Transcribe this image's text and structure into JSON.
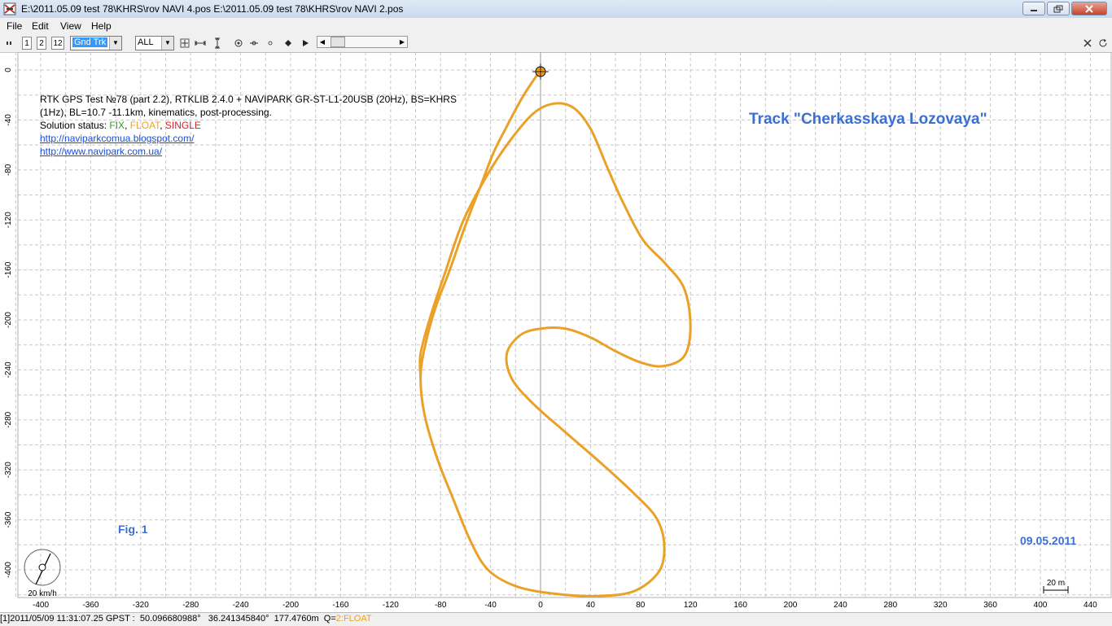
{
  "window": {
    "title": "E:\\2011.05.09 test 78\\KHRS\\rov NAVI 4.pos E:\\2011.05.09 test 78\\KHRS\\rov NAVI 2.pos",
    "min_icon": "minimize-icon",
    "max_icon": "maximize-icon",
    "close_icon": "close-icon"
  },
  "menu": {
    "file": "File",
    "edit": "Edit",
    "view": "View",
    "help": "Help"
  },
  "toolbar": {
    "btn1": "1",
    "btn2": "2",
    "btn12": "12",
    "plot_type": "Gnd Trk",
    "quality": "ALL"
  },
  "annotation": {
    "line1": "RTK GPS Test №78 (part 2.2), RTKLIB 2.4.0 + NAVIPARK GR-ST-L1-20USB (20Hz), BS=KHRS",
    "line2": "(1Hz), BL=10.7 -11.1km, kinematics, post-processing.",
    "status_label": "Solution status: ",
    "fix": "FIX",
    "float": "FLOAT",
    "single": "SINGLE",
    "sep": ", ",
    "link1": "http://naviparkcomua.blogspot.com/",
    "link2": "http://www.navipark.com.ua/"
  },
  "track_title": "Track \"Cherkasskaya Lozovaya\"",
  "fig_label": "Fig. 1",
  "date_label": "09.05.2011",
  "scale_label": "20 m",
  "velocity_label": "20 km/h",
  "status_bar": {
    "left": "[1]2011/05/09 11:31:07.25 GPST :  50.096680988°   36.241345840°  177.4760m  Q=",
    "quality": "2:FLOAT"
  },
  "colors": {
    "fix": "#2e9e2e",
    "float": "#f0a020",
    "single": "#e02020",
    "track": "#eaa128",
    "accent": "#3c6fd0"
  },
  "chart_data": {
    "type": "line",
    "xlim": [
      -400,
      440
    ],
    "ylim": [
      -400,
      0
    ],
    "xticks": [
      -400,
      -360,
      -320,
      -280,
      -240,
      -200,
      -160,
      -120,
      -80,
      -40,
      0,
      40,
      80,
      120,
      160,
      200,
      240,
      280,
      320,
      360,
      400,
      440
    ],
    "yticks": [
      0,
      -40,
      -80,
      -120,
      -160,
      -200,
      -240,
      -280,
      -320,
      -360,
      -400
    ],
    "grid": true,
    "series": [
      {
        "points": [
          [
            0,
            0
          ],
          [
            -14,
            -21
          ],
          [
            -28,
            -47
          ],
          [
            -38,
            -67
          ],
          [
            -48,
            -93
          ],
          [
            -60,
            -124
          ],
          [
            -73,
            -161
          ],
          [
            -84,
            -190
          ],
          [
            -92,
            -219
          ],
          [
            -96,
            -245
          ],
          [
            -93,
            -275
          ],
          [
            -83,
            -310
          ],
          [
            -70,
            -343
          ],
          [
            -56,
            -377
          ],
          [
            -42,
            -400
          ],
          [
            -20,
            -413
          ],
          [
            10,
            -419
          ],
          [
            45,
            -421
          ],
          [
            75,
            -417
          ],
          [
            95,
            -401
          ],
          [
            99,
            -380
          ],
          [
            93,
            -359
          ],
          [
            77,
            -341
          ],
          [
            50,
            -316
          ],
          [
            20,
            -290
          ],
          [
            -6,
            -267
          ],
          [
            -23,
            -247
          ],
          [
            -27,
            -227
          ],
          [
            -16,
            -212
          ],
          [
            0,
            -207
          ],
          [
            20,
            -207
          ],
          [
            40,
            -214
          ],
          [
            60,
            -225
          ],
          [
            80,
            -234
          ],
          [
            98,
            -237
          ],
          [
            115,
            -229
          ],
          [
            120,
            -205
          ],
          [
            115,
            -175
          ],
          [
            100,
            -155
          ],
          [
            82,
            -136
          ],
          [
            66,
            -106
          ],
          [
            53,
            -77
          ],
          [
            40,
            -47
          ],
          [
            26,
            -30
          ],
          [
            10,
            -27
          ],
          [
            -6,
            -35
          ],
          [
            -24,
            -56
          ],
          [
            -42,
            -83
          ],
          [
            -62,
            -121
          ],
          [
            -77,
            -164
          ],
          [
            -88,
            -197
          ],
          [
            -96,
            -227
          ],
          [
            -96,
            -245
          ]
        ]
      }
    ]
  }
}
